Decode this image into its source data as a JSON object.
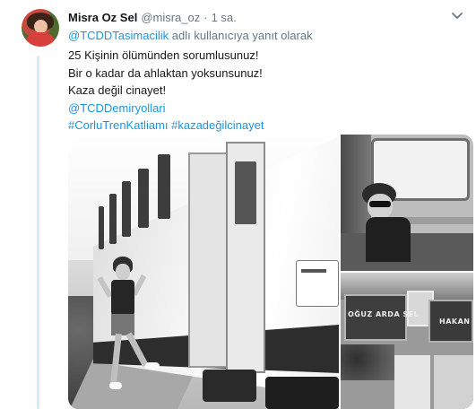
{
  "tweet": {
    "author_name": "Misra Oz Sel",
    "author_handle": "@misra_oz",
    "separator": "·",
    "timestamp": "1 sa.",
    "replying_mention": "@TCDDTasimacilik",
    "replying_suffix": " adlı kullanıcıya yanıt olarak",
    "lines": [
      "25 Kişinin ölümünden sorumlusunuz!",
      "Bir o kadar da ahlaktan yoksunsunuz!",
      "Kaza değil cinayet!"
    ],
    "mention_line": "@TCDDemiryollari",
    "hashtag_line": "#CorluTrenKatliamı #kazadeğilcinayet"
  },
  "media": {
    "photo_count": 3,
    "grave_labels": [
      "OĞUZ ARDA SEL",
      "HAKAN"
    ]
  },
  "colors": {
    "link": "#1b95e0",
    "secondary_text": "#657786",
    "thread_line": "#d5eaf7"
  },
  "icons": {
    "menu": "chevron-down-icon"
  }
}
